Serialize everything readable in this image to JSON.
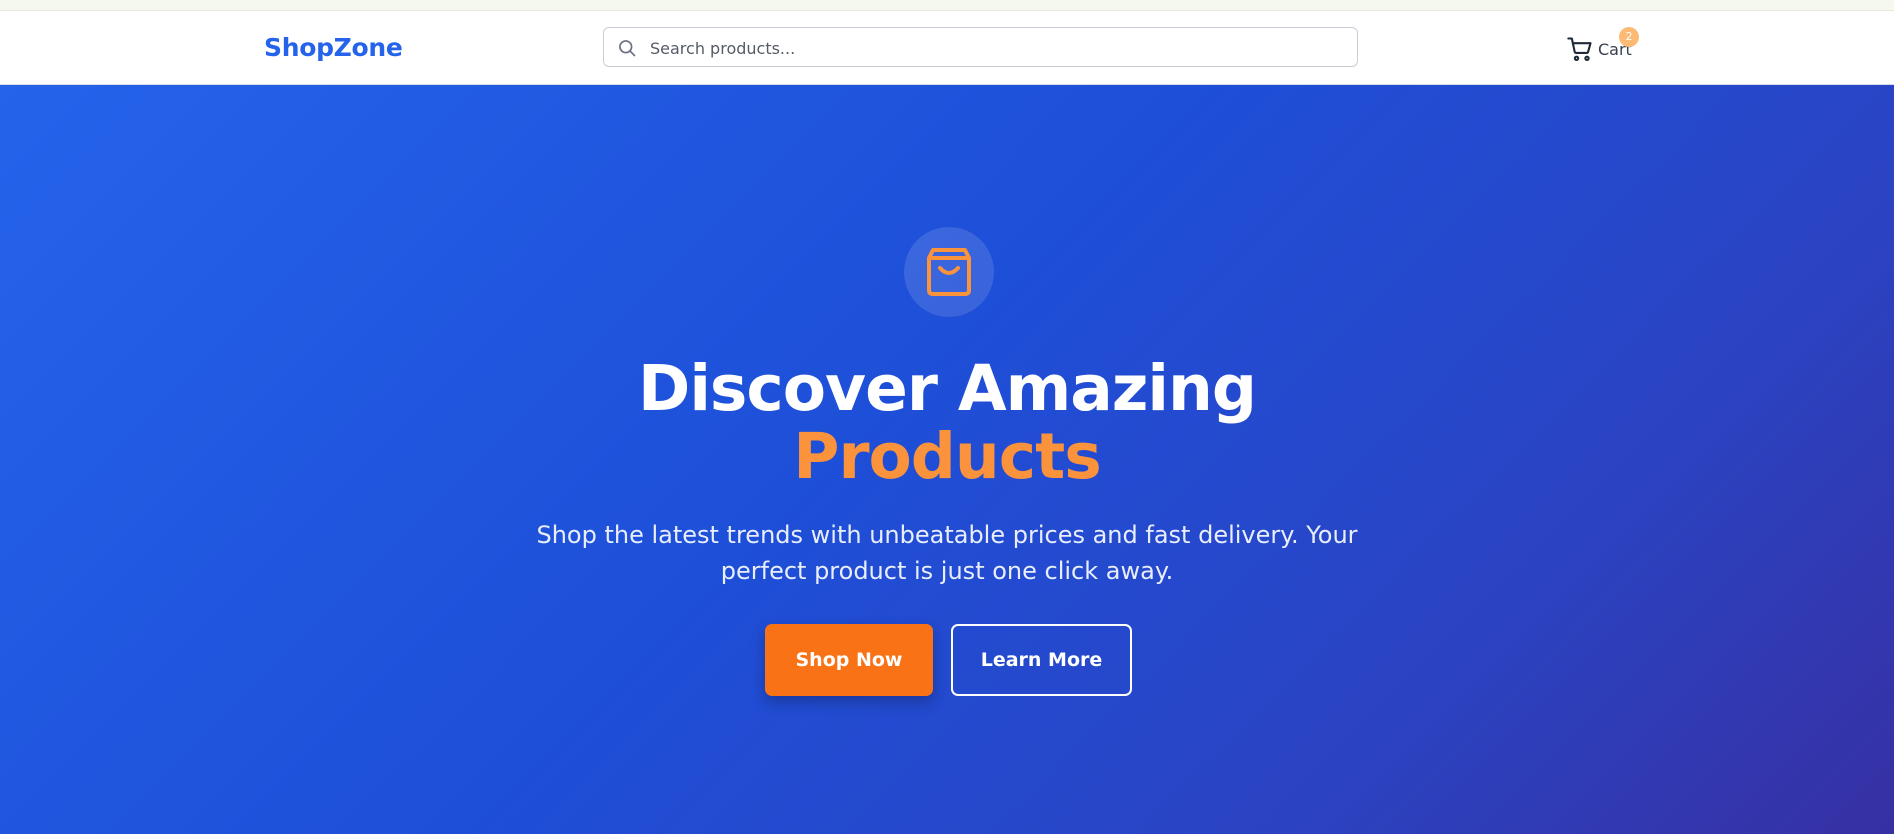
{
  "header": {
    "logo": "ShopZone",
    "search": {
      "placeholder": "Search products...",
      "icon": "search-icon"
    },
    "cart": {
      "label": "Cart",
      "count": "2",
      "icon": "cart-icon"
    }
  },
  "hero": {
    "icon": "shopping-bag-icon",
    "title_line1": "Discover Amazing",
    "title_line2": "Products",
    "subtitle": "Shop the latest trends with unbeatable prices and fast delivery. Your perfect product is just one click away.",
    "primary_button": "Shop Now",
    "secondary_button": "Learn More"
  },
  "colors": {
    "brand": "#2563eb",
    "accent": "#f97316",
    "hero_gradient_start": "#2563eb",
    "hero_gradient_end": "#3730a3"
  }
}
